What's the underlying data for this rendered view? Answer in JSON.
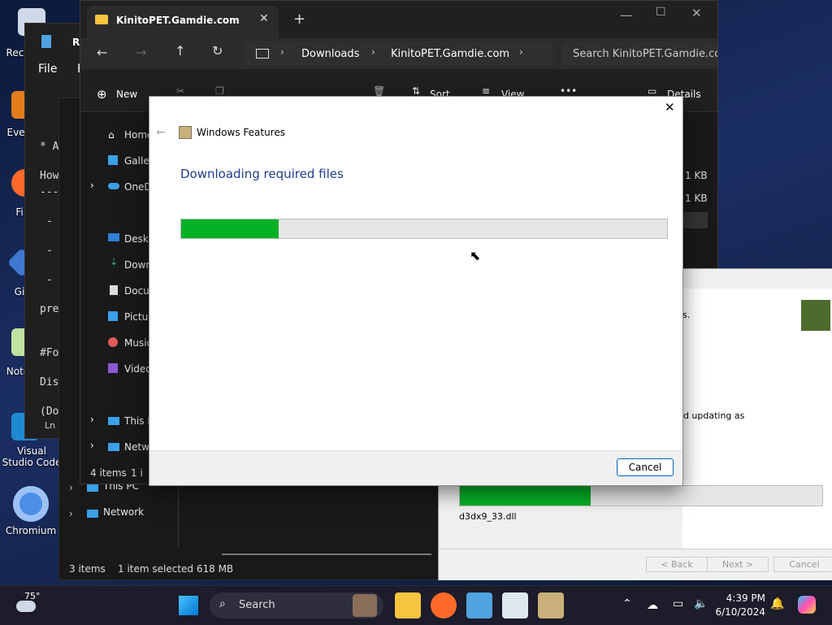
{
  "desktop": {
    "icons": [
      {
        "label": "Recy"
      },
      {
        "label": "Ever"
      },
      {
        "label": "Fi"
      },
      {
        "label": "Gi"
      },
      {
        "label": "Note"
      },
      {
        "label": "Visual Studio Code"
      },
      {
        "label": "Chromium"
      }
    ]
  },
  "notepad": {
    "title": "Re",
    "menu_file": "File",
    "menu_edit": "E",
    "lines": [
      "* A",
      "How",
      "---",
      "-",
      "-",
      "-",
      "pre",
      "#Fo",
      "Dis",
      "(Do"
    ],
    "status": "Ln"
  },
  "explorer": {
    "tab_title": "KinitoPET.Gamdie.com",
    "breadcrumb": [
      "Downloads",
      "KinitoPET.Gamdie.com"
    ],
    "search_placeholder": "Search KinitoPET.Gamdie.com",
    "cmd_new": "New",
    "cmd_sort": "Sort",
    "cmd_view": "View",
    "cmd_details": "Details",
    "nav": [
      "Home",
      "Galler",
      "OneD",
      "Deskt",
      "Down",
      "Docu",
      "Pictur",
      "Music",
      "Video",
      "This P",
      "Netwo"
    ],
    "sizes": [
      "1 KB",
      "1 KB"
    ],
    "status_items": "4 items",
    "status_sep": "1 i"
  },
  "explorer_back": {
    "nav_this_pc": "This PC",
    "nav_network": "Network",
    "status_items": "3 items",
    "status_selected": "1 item selected  618 MB"
  },
  "installer": {
    "text1": "s.",
    "text2": "s and updating as",
    "file": "d3dx9_33.dll",
    "progress": 0.36,
    "back": "< Back",
    "next": "Next >",
    "cancel": "Cancel"
  },
  "dialog": {
    "title": "Windows Features",
    "heading": "Downloading required files",
    "progress": 0.2,
    "cancel": "Cancel"
  },
  "taskbar": {
    "weather": "75°",
    "search": "Search",
    "time": "4:39 PM",
    "date": "6/10/2024"
  }
}
